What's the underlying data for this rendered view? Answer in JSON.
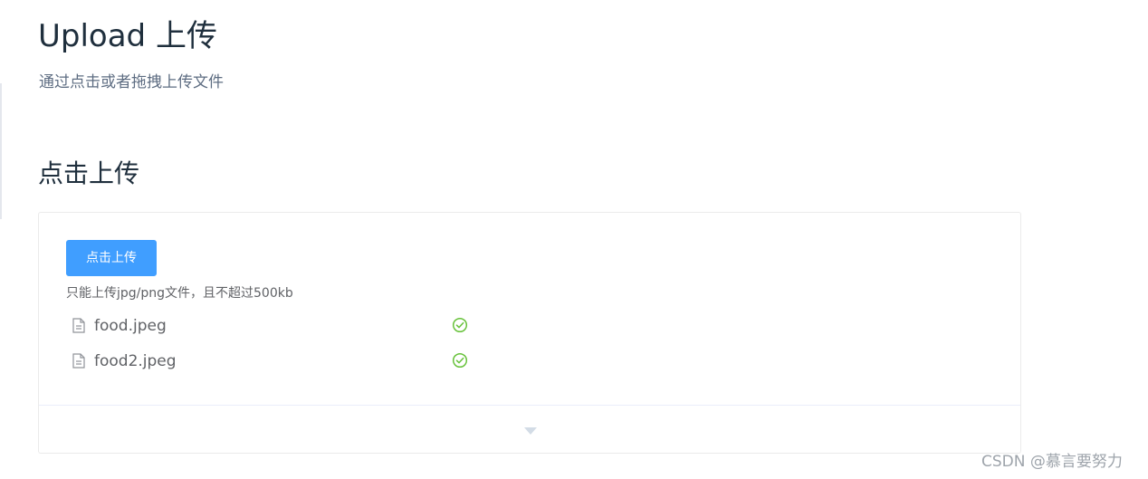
{
  "page": {
    "title": "Upload 上传",
    "description": "通过点击或者拖拽上传文件"
  },
  "section": {
    "title": "点击上传"
  },
  "upload": {
    "button_label": "点击上传",
    "tip": "只能上传jpg/png文件，且不超过500kb",
    "files": [
      {
        "name": "food.jpeg",
        "icon": "document-icon",
        "status": "success",
        "status_icon": "check-circle-icon"
      },
      {
        "name": "food2.jpeg",
        "icon": "document-icon",
        "status": "success",
        "status_icon": "check-circle-icon"
      }
    ]
  },
  "demo_control": {
    "icon": "caret-down-icon"
  },
  "watermark": {
    "text": "CSDN @慕言要努力"
  },
  "colors": {
    "primary": "#409eff",
    "success": "#67c23a",
    "title_text": "#1f2f3d",
    "secondary_text": "#606266",
    "border": "#ebebeb"
  }
}
